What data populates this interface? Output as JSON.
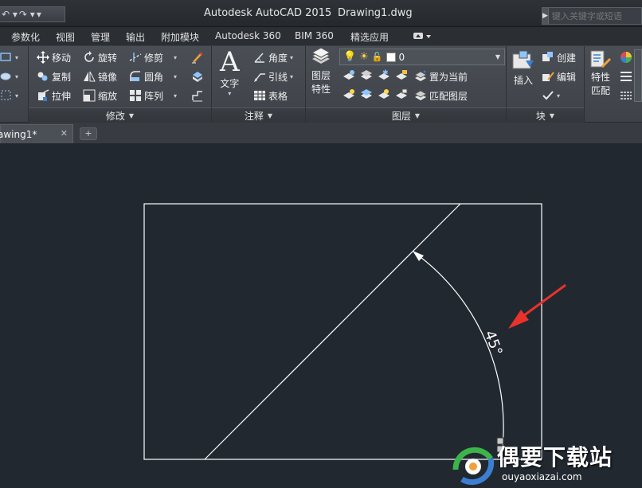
{
  "window": {
    "app_title": "Autodesk AutoCAD 2015",
    "doc_title": "Drawing1.dwg",
    "search_placeholder": "键入关键字或短语"
  },
  "qat": {
    "undo": "↶ ▾",
    "redo": "↷ ▾",
    "customize": "▾"
  },
  "tabs": [
    "参数化",
    "视图",
    "管理",
    "输出",
    "附加模块",
    "Autodesk 360",
    "BIM 360",
    "精选应用"
  ],
  "modify_panel": {
    "title": "修改",
    "buttons": [
      "移动",
      "旋转",
      "修剪",
      "复制",
      "镜像",
      "圆角",
      "拉伸",
      "缩放",
      "阵列"
    ]
  },
  "annotation_panel": {
    "title": "注释",
    "text_button": "文字",
    "buttons": [
      "角度",
      "引线",
      "表格"
    ]
  },
  "layers_panel": {
    "title": "图层",
    "current_layer": "0",
    "properties_button": [
      "图层",
      "特性"
    ],
    "buttons": [
      "置为当前",
      "匹配图层"
    ]
  },
  "block_panel": {
    "title": "块",
    "insert_button": "插入",
    "buttons": [
      "创建",
      "编辑"
    ]
  },
  "properties_panel": {
    "button": [
      "特性",
      "匹配"
    ]
  },
  "doc_tab": {
    "name": "awing1*",
    "close": "✕",
    "new": "+"
  },
  "drawing": {
    "dimension_text": "45°",
    "angle_degrees": 45
  },
  "watermark": {
    "title": "偶要下载站",
    "url": "ouyaoxiazai.com"
  },
  "colors": {
    "canvas": "#212830",
    "geometry": "#ffffff",
    "arrow": "#e8322c"
  }
}
